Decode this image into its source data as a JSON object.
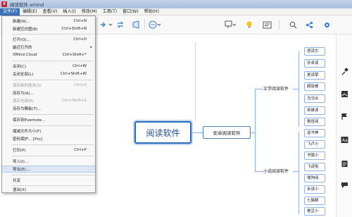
{
  "window": {
    "title": "阅读软件.xmind",
    "app_icon_text": "X"
  },
  "menubar": [
    {
      "label": "文件(F)",
      "active": true
    },
    {
      "label": "编辑(E)"
    },
    {
      "label": "查看(V)"
    },
    {
      "label": "插入(I)"
    },
    {
      "label": "修改(M)"
    },
    {
      "label": "工具(T)"
    },
    {
      "label": "窗口(W)"
    },
    {
      "label": "帮助(H)"
    }
  ],
  "file_menu": [
    {
      "label": "新建(N)...",
      "shortcut": "Ctrl+N"
    },
    {
      "label": "新建空白图(B)",
      "shortcut": "Ctrl+Shift+N"
    },
    {
      "separator": true
    },
    {
      "label": "打开(O)...",
      "shortcut": "Ctrl+O"
    },
    {
      "label": "最近打开的",
      "submenu": true
    },
    {
      "label": "XMind Cloud",
      "shortcut": "Ctrl+Shift+*"
    },
    {
      "separator": true
    },
    {
      "label": "关闭(C)",
      "shortcut": "Ctrl+W"
    },
    {
      "label": "关闭全部(L)",
      "shortcut": "Ctrl+Shift+W"
    },
    {
      "separator": true
    },
    {
      "label": "保存新的版本(S)",
      "shortcut": "Ctrl+S",
      "disabled": true
    },
    {
      "label": "另存为(A)..."
    },
    {
      "label": "保存全部(E)",
      "shortcut": "Ctrl+Shift+S",
      "disabled": true
    },
    {
      "label": "另存为模板(T)..."
    },
    {
      "separator": true
    },
    {
      "label": "保存到Evernote..."
    },
    {
      "separator": true
    },
    {
      "label": "缩减文件大小(F)"
    },
    {
      "label": "密码保护... [Pro]"
    },
    {
      "separator": true
    },
    {
      "label": "打印(P)",
      "shortcut": "Ctrl+P"
    },
    {
      "separator": true
    },
    {
      "label": "导入(I)..."
    },
    {
      "label": "导出(E)...",
      "hover": true
    },
    {
      "separator": true
    },
    {
      "label": "共享"
    },
    {
      "separator": true
    },
    {
      "label": "退出(X)"
    }
  ],
  "mindmap": {
    "central": "阅读软件",
    "main_topic": "安卓阅读软件",
    "subtopics": [
      "文学阅读软件",
      "小说阅读软件"
    ],
    "leaves_top": [
      "塔读文",
      "安卓读",
      "爱读掌",
      "超级看",
      "当当云",
      "英雄读",
      "鲁班阅"
    ],
    "leaves_bottom": [
      "追书神",
      "飞卢小",
      "书旗小",
      "飞读免",
      "搜狗阅",
      "米读小",
      "七猫精",
      "看豆小"
    ]
  },
  "icons": {
    "toolbar": [
      "arrow-icon",
      "chevron-down-icon",
      "relationship-icon",
      "boundary-icon",
      "more-icon",
      "presentation-icon",
      "lightbulb-icon",
      "outline-icon",
      "search-icon",
      "share-icon",
      "settings-icon"
    ],
    "sidebar": [
      "format-brush-icon",
      "image-icon",
      "marker-flag-icon",
      "text-icon",
      "task-icon",
      "comment-icon"
    ]
  },
  "colors": {
    "accent": "#2f6bbd",
    "menu_active": "#3b6fb6",
    "line": "#8ab0e4"
  }
}
